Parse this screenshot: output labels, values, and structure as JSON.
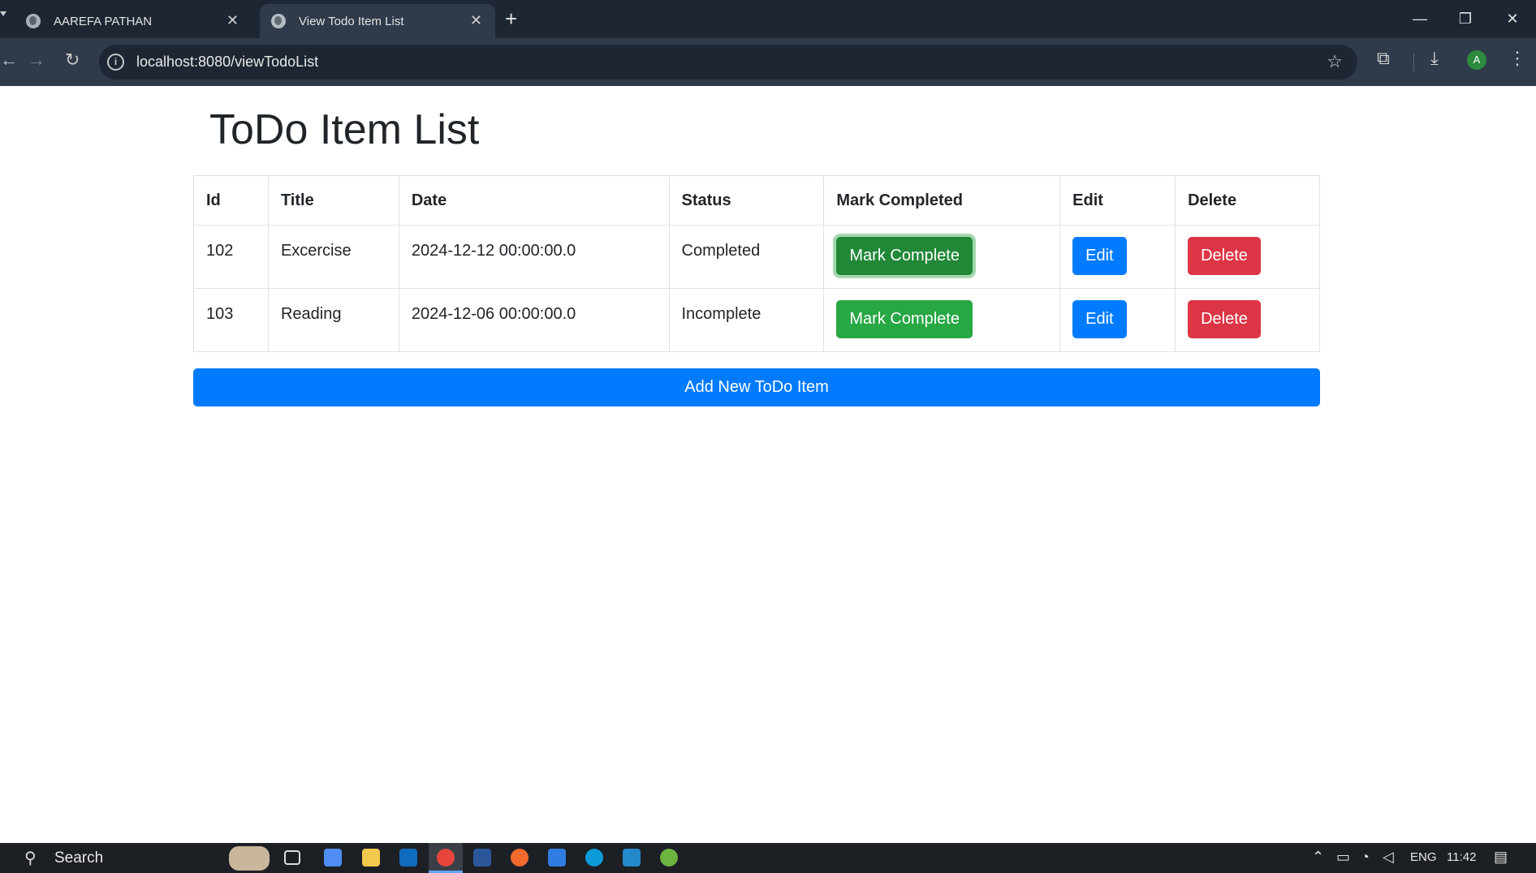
{
  "browser": {
    "tabs": [
      {
        "title": "AAREFA PATHAN",
        "close": "✕"
      },
      {
        "title": "View Todo Item List",
        "close": "✕"
      }
    ],
    "new_tab": "+",
    "url": "localhost:8080/viewTodoList",
    "window": {
      "minimize": "—",
      "restore": "❐",
      "close": "✕"
    },
    "profile_initial": "A"
  },
  "page": {
    "title": "ToDo Item List",
    "columns": [
      "Id",
      "Title",
      "Date",
      "Status",
      "Mark Completed",
      "Edit",
      "Delete"
    ],
    "rows": [
      {
        "id": "102",
        "title": "Excercise",
        "date": "2024-12-12 00:00:00.0",
        "status": "Completed",
        "mark": "Mark Complete",
        "edit": "Edit",
        "delete": "Delete"
      },
      {
        "id": "103",
        "title": "Reading",
        "date": "2024-12-06 00:00:00.0",
        "status": "Incomplete",
        "mark": "Mark Complete",
        "edit": "Edit",
        "delete": "Delete"
      }
    ],
    "add_button": "Add New ToDo Item"
  },
  "taskbar": {
    "search": "Search",
    "language": "ENG",
    "time": "11:42"
  },
  "colors": {
    "success": "#28a745",
    "primary": "#007bff",
    "danger": "#dc3545"
  }
}
